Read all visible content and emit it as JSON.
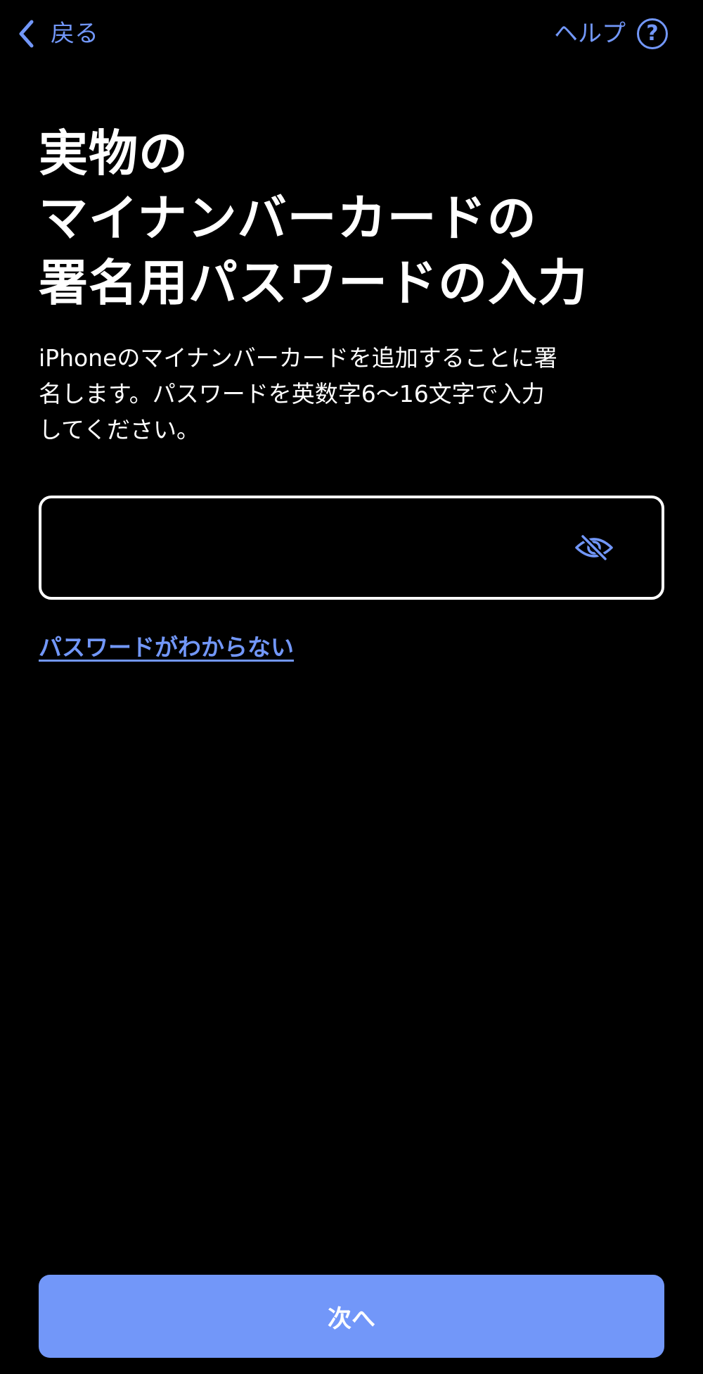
{
  "nav": {
    "back_label": "戻る",
    "help_label": "ヘルプ",
    "help_icon_glyph": "?"
  },
  "title": {
    "line1": "実物の",
    "line2": "マイナンバーカードの",
    "line3": "署名用パスワードの入力"
  },
  "description": {
    "line1": "iPhoneのマイナンバーカードを追加することに署",
    "line2": "名します。パスワードを英数字6〜16文字で入力",
    "line3": "してください。"
  },
  "password_field": {
    "value": "",
    "placeholder": "",
    "visibility_icon": "eye-slash-icon"
  },
  "forgot_link": "パスワードがわからない",
  "next_button": "次へ",
  "colors": {
    "background": "#000000",
    "accent": "#7297f9",
    "text": "#ffffff"
  }
}
